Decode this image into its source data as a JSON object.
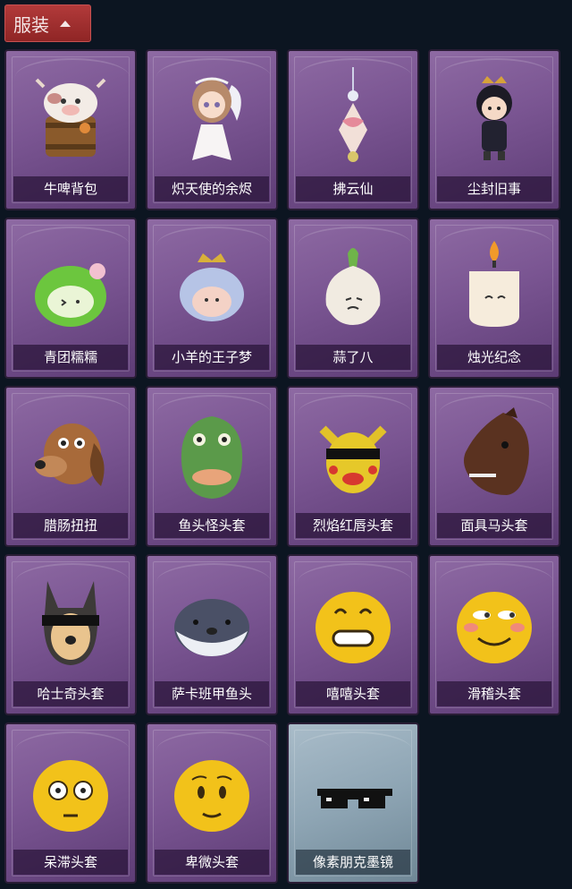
{
  "header": {
    "label": "服装"
  },
  "items": [
    {
      "label": "牛啤背包",
      "icon": "cow-beer-backpack-icon"
    },
    {
      "label": "炽天使的余烬",
      "icon": "seraph-doll-icon"
    },
    {
      "label": "拂云仙",
      "icon": "cloud-fairy-pendant-icon"
    },
    {
      "label": "尘封旧事",
      "icon": "chibi-figure-icon"
    },
    {
      "label": "青团糯糯",
      "icon": "green-mochi-icon"
    },
    {
      "label": "小羊的王子梦",
      "icon": "sheep-prince-icon"
    },
    {
      "label": "蒜了八",
      "icon": "garlic-icon"
    },
    {
      "label": "烛光纪念",
      "icon": "candle-icon"
    },
    {
      "label": "腊肠扭扭",
      "icon": "dachshund-mask-icon"
    },
    {
      "label": "鱼头怪头套",
      "icon": "fish-head-mask-icon"
    },
    {
      "label": "烈焰红唇头套",
      "icon": "pikachu-mask-icon"
    },
    {
      "label": "面具马头套",
      "icon": "horse-mask-icon"
    },
    {
      "label": "哈士奇头套",
      "icon": "husky-mask-icon"
    },
    {
      "label": "萨卡班甲鱼头",
      "icon": "sacabambaspis-head-icon"
    },
    {
      "label": "嘻嘻头套",
      "icon": "grin-emoji-head-icon"
    },
    {
      "label": "滑稽头套",
      "icon": "smirk-emoji-head-icon"
    },
    {
      "label": "呆滞头套",
      "icon": "flushed-emoji-head-icon"
    },
    {
      "label": "卑微头套",
      "icon": "pleading-emoji-head-icon"
    },
    {
      "label": "像素朋克墨镜",
      "icon": "pixel-sunglasses-icon"
    }
  ],
  "colors": {
    "rare_card": "#7a5592",
    "common_card": "#8ea5b4",
    "header": "#a53232"
  }
}
